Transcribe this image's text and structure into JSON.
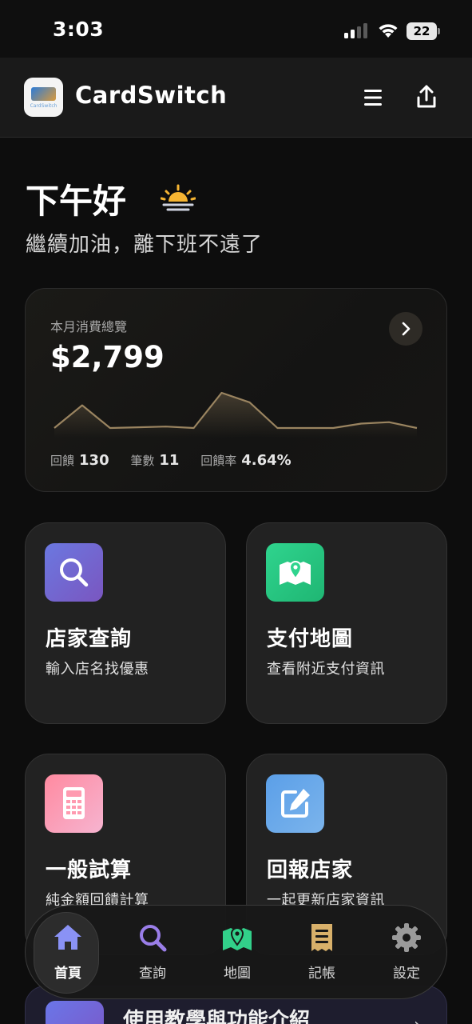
{
  "status_bar": {
    "time": "3:03",
    "battery": "22"
  },
  "header": {
    "title": "CardSwitch",
    "logo_text": "CardSwitch"
  },
  "greeting": {
    "title": "下午好",
    "subtitle": "繼續加油，離下班不遠了"
  },
  "summary": {
    "label": "本月消費總覽",
    "amount": "$2,799",
    "stats": [
      {
        "label": "回饋",
        "value": "130"
      },
      {
        "label": "筆數",
        "value": "11"
      },
      {
        "label": "回饋率",
        "value": "4.64%"
      }
    ]
  },
  "chart_data": {
    "type": "line",
    "title": "",
    "xlabel": "",
    "ylabel": "",
    "x": [
      1,
      2,
      3,
      4,
      5,
      6,
      7,
      8,
      9,
      10,
      11,
      12,
      13,
      14
    ],
    "series": [
      {
        "values": [
          0,
          31,
          0,
          1,
          2,
          0,
          48,
          35,
          0,
          0,
          0,
          6,
          8,
          0
        ]
      }
    ],
    "grid": false,
    "colors": {
      "line": "#9a8460"
    }
  },
  "tiles": [
    {
      "title": "店家查詢",
      "subtitle": "輸入店名找優惠",
      "icon": "search-icon"
    },
    {
      "title": "支付地圖",
      "subtitle": "查看附近支付資訊",
      "icon": "map-icon"
    },
    {
      "title": "一般試算",
      "subtitle": "純金額回饋計算",
      "icon": "calculator-icon"
    },
    {
      "title": "回報店家",
      "subtitle": "一起更新店家資訊",
      "icon": "edit-icon"
    }
  ],
  "peek_card": {
    "title": "使用教學與功能介紹",
    "arrow": "›"
  },
  "tab_bar": {
    "items": [
      {
        "label": "首頁",
        "icon": "home-icon",
        "active": true
      },
      {
        "label": "查詢",
        "icon": "search-icon",
        "active": false
      },
      {
        "label": "地圖",
        "icon": "map-icon",
        "active": false
      },
      {
        "label": "記帳",
        "icon": "receipt-icon",
        "active": false
      },
      {
        "label": "設定",
        "icon": "gear-icon",
        "active": false
      }
    ]
  },
  "colors": {
    "background": "#0d0d0d",
    "accent_home": "#8a92f5",
    "accent_search": "#9a7ee8",
    "accent_map": "#32d08a",
    "accent_receipt": "#d8b06a",
    "accent_gear": "#9a9a9a"
  }
}
